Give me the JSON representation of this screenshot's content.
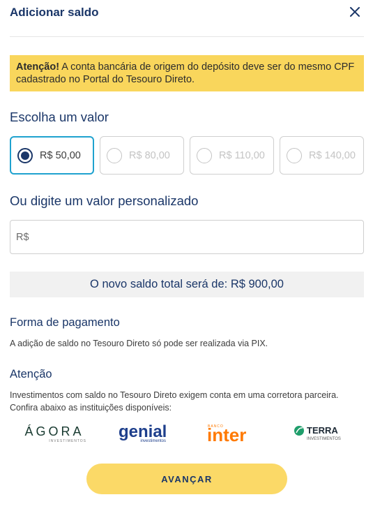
{
  "header": {
    "title": "Adicionar saldo",
    "close_icon": "close-icon"
  },
  "warning": {
    "strong": "Atenção!",
    "text": " A conta bancária de origem do depósito deve ser do mesmo CPF cadastrado no Portal do Tesouro Direto."
  },
  "choose": {
    "title": "Escolha um valor",
    "options": [
      {
        "label": "R$ 50,00",
        "selected": true
      },
      {
        "label": "R$ 80,00",
        "selected": false
      },
      {
        "label": "R$ 110,00",
        "selected": false
      },
      {
        "label": "R$ 140,00",
        "selected": false
      }
    ]
  },
  "custom": {
    "title": "Ou digite um valor personalizado",
    "placeholder": "R$",
    "value": ""
  },
  "summary": {
    "text": "O novo saldo total será de: R$ 900,00"
  },
  "payment": {
    "title": "Forma de pagamento",
    "text": "A adição de saldo no Tesouro Direto só pode ser realizada via PIX."
  },
  "attention": {
    "title": "Atenção",
    "text_line1": "Investimentos com saldo no Tesouro Direto exigem conta em uma corretora parceira.",
    "text_line2": "Confira abaixo as instituições disponíveis:"
  },
  "brokers": {
    "agora": {
      "name": "ÁGORA",
      "sub": "INVESTIMENTOS"
    },
    "genial": {
      "name": "genial",
      "sub": "investimentos"
    },
    "inter": {
      "name": "inter",
      "sub": "BANCO"
    },
    "terra": {
      "name": "TERRA",
      "sub": "INVESTIMENTOS"
    }
  },
  "cta": {
    "label": "AVANÇAR"
  },
  "colors": {
    "primary": "#1a3668",
    "accent": "#1fa2cf",
    "warning": "#f9d65c",
    "cta": "#fbd967"
  }
}
